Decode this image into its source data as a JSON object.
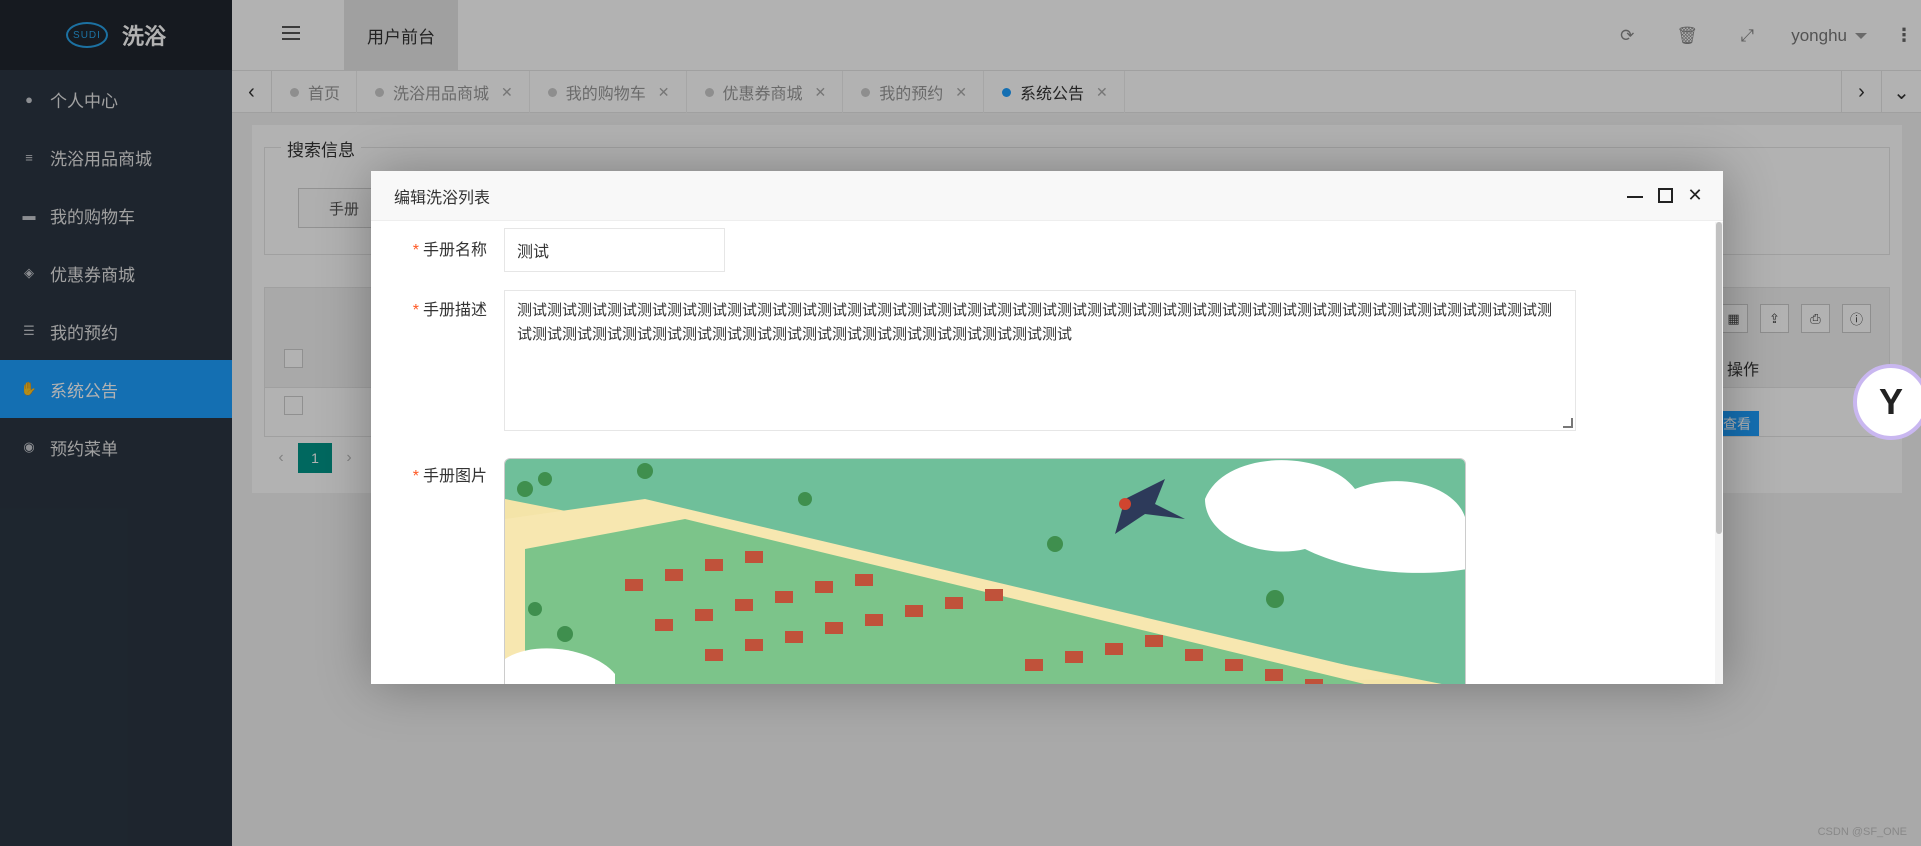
{
  "brand": {
    "logo_text": "SUDI",
    "title": "洗浴"
  },
  "sidebar": {
    "items": [
      {
        "label": "个人中心",
        "icon": "user-icon",
        "glyph": "●"
      },
      {
        "label": "洗浴用品商城",
        "icon": "shop-icon",
        "glyph": "≡"
      },
      {
        "label": "我的购物车",
        "icon": "cart-icon",
        "glyph": "▬"
      },
      {
        "label": "优惠券商城",
        "icon": "tag-icon",
        "glyph": "◈"
      },
      {
        "label": "我的预约",
        "icon": "list-icon",
        "glyph": "☰"
      },
      {
        "label": "系统公告",
        "icon": "hand-icon",
        "glyph": "✋",
        "active": true
      },
      {
        "label": "预约菜单",
        "icon": "compass-icon",
        "glyph": "◉"
      }
    ]
  },
  "header": {
    "front_tab": "用户前台",
    "user": "yonghu"
  },
  "tabs": [
    {
      "label": "首页",
      "active": false
    },
    {
      "label": "洗浴用品商城",
      "active": false
    },
    {
      "label": "我的购物车",
      "active": false
    },
    {
      "label": "优惠券商城",
      "active": false
    },
    {
      "label": "我的预约",
      "active": false
    },
    {
      "label": "系统公告",
      "active": true
    }
  ],
  "main": {
    "search_legend": "搜索信息",
    "search_button": "手册",
    "op_header": "操作",
    "view_button": "查看",
    "page_current": "1"
  },
  "modal": {
    "title": "编辑洗浴列表",
    "fields": {
      "name_label": "手册名称",
      "name_value": "测试",
      "desc_label": "手册描述",
      "desc_value": "测试测试测试测试测试测试测试测试测试测试测试测试测试测试测试测试测试测试测试测试测试测试测试测试测试测试测试测试测试测试测试测试测试测试测试测试测试测试测试测试测试测试测试测试测试测试测试测试测试测试测试测试测试",
      "image_label": "手册图片"
    }
  },
  "watermark": "CSDN @SF_ONE",
  "colors": {
    "sidebar": "#2b3643",
    "accent": "#1e9fff",
    "pager": "#009688"
  }
}
